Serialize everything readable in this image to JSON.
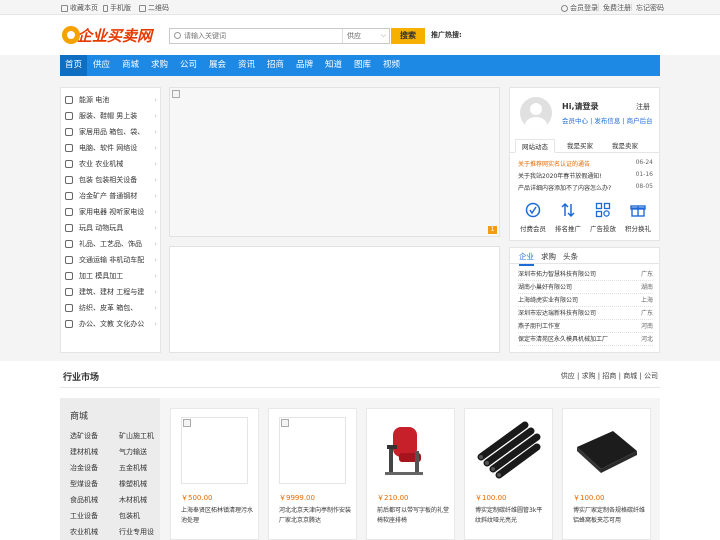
{
  "topbar": {
    "left": [
      "收藏本页",
      "手机版",
      "二维码"
    ],
    "right": [
      "会员登录",
      "免费注册",
      "忘记密码"
    ]
  },
  "logo": {
    "text": "企业买卖网"
  },
  "search": {
    "placeholder": "请输入关键词",
    "type_selected": "供应",
    "button": "搜索",
    "hot_label": "推广热搜:"
  },
  "nav": {
    "items": [
      "首页",
      "供应",
      "商城",
      "求购",
      "公司",
      "展会",
      "资讯",
      "招商",
      "品牌",
      "知道",
      "图库",
      "视频"
    ],
    "active_index": 0
  },
  "categories": [
    "能源 电池",
    "服装、鞋帽 男上装",
    "家居用品 箱包、袋、",
    "电脑、软件 网络设",
    "农业 农业机械",
    "包装 包装相关设备",
    "冶金矿产 普通钢材",
    "家用电器 视听家电设",
    "玩具 动物玩具",
    "礼品、工艺品、饰品",
    "交通运输 非机动车配",
    "加工 模具加工",
    "建筑、建材 工程与建",
    "纺织、皮革 箱包、",
    "办公、文教 文化办公"
  ],
  "banner_badge": "1",
  "user": {
    "greeting": "Hi,请登录",
    "register": "注册",
    "links": [
      "会员中心",
      "发布信息",
      "商户后台"
    ],
    "tabs": [
      "网站动态",
      "我是买家",
      "我是卖家"
    ],
    "news": [
      {
        "title": "关于推荐网实名认证的通告",
        "date": "06-24",
        "highlight": true
      },
      {
        "title": "关于我站2020年春节放假通知!",
        "date": "01-16",
        "highlight": false
      },
      {
        "title": "产品详细内容添加不了内容怎么办?",
        "date": "08-05",
        "highlight": false
      }
    ],
    "quick": [
      "付费会员",
      "排名推广",
      "广告投放",
      "积分换礼"
    ]
  },
  "companies": {
    "tabs": [
      "企业",
      "求购",
      "头条"
    ],
    "rows": [
      {
        "name": "深圳市拓力智慧科技有限公司",
        "province": "广东"
      },
      {
        "name": "湖南小巢好有限公司",
        "province": "湖南"
      },
      {
        "name": "上海绮虎实业有限公司",
        "province": "上海"
      },
      {
        "name": "深圳市宏达瑞新科技有限公司",
        "province": "广东"
      },
      {
        "name": "燕子朋刊工作室",
        "province": "河南"
      },
      {
        "name": "保定市清苑区永久模具机械加工厂",
        "province": "河北"
      }
    ]
  },
  "market": {
    "title": "行业市场",
    "links": [
      "供应",
      "求购",
      "招商",
      "商城",
      "公司"
    ],
    "side_title": "商城",
    "side_links": [
      [
        "选矿设备",
        "矿山施工机"
      ],
      [
        "建材机械",
        "气力输送"
      ],
      [
        "冶金设备",
        "五金机械"
      ],
      [
        "型煤设备",
        "橡塑机械"
      ],
      [
        "食品机械",
        "木材机械"
      ],
      [
        "工业设备",
        "包装机"
      ],
      [
        "农业机械",
        "行业专用设"
      ]
    ],
    "products": [
      {
        "price": "￥500.00",
        "name": "上海奉贤区柘林镇清理污水池处理",
        "image": "broken"
      },
      {
        "price": "￥9999.00",
        "name": "河北北京天津向亭制作安装厂家北京京腾达",
        "image": "broken"
      },
      {
        "price": "￥210.00",
        "name": "前后都可以带写字板的礼堂椅软座排椅",
        "image": "red-chair"
      },
      {
        "price": "￥100.00",
        "name": "博实定制碳纤维圆管3k平纹斜纹哑光亮光",
        "image": "black-tubes"
      },
      {
        "price": "￥100.00",
        "name": "博实厂家定制各规格碳纤维铝蜂窝板夹芯可用",
        "image": "black-panel"
      }
    ]
  }
}
